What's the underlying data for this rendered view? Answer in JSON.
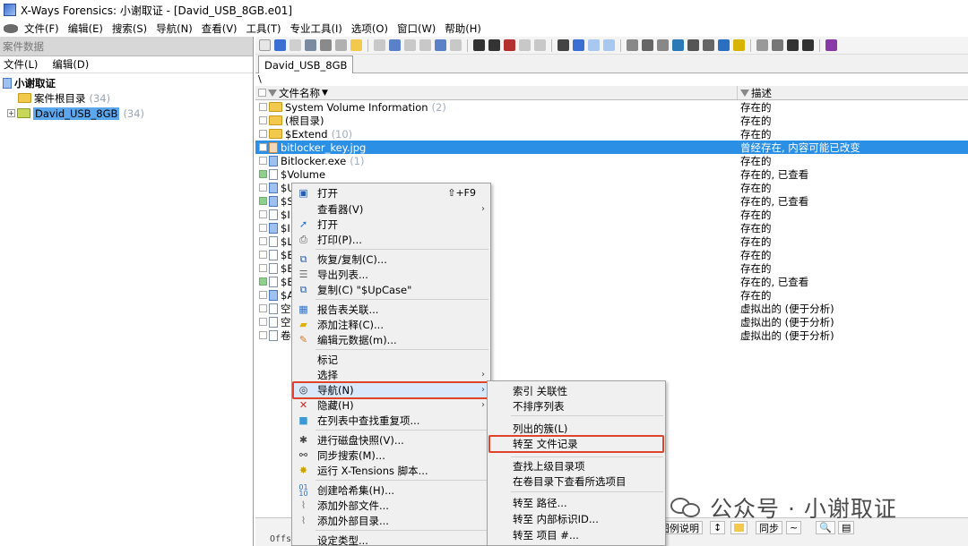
{
  "window": {
    "title": "X-Ways Forensics: 小谢取证 - [David_USB_8GB.e01]"
  },
  "menubar": [
    "文件(F)",
    "编辑(E)",
    "搜索(S)",
    "导航(N)",
    "查看(V)",
    "工具(T)",
    "专业工具(I)",
    "选项(O)",
    "窗口(W)",
    "帮助(H)"
  ],
  "left_pane": {
    "header": "案件数据",
    "menu": [
      "文件(L)",
      "编辑(D)"
    ],
    "tree": {
      "root": "小谢取证",
      "items": [
        {
          "label": "案件根目录",
          "count": "(34)"
        },
        {
          "label": "David_USB_8GB",
          "count": "(34)"
        }
      ]
    }
  },
  "tab": {
    "label": "David_USB_8GB"
  },
  "path": "\\",
  "columns": {
    "name": "文件名称",
    "desc": "描述"
  },
  "rows": [
    {
      "name": "System Volume Information",
      "count": "(2)",
      "desc": "存在的"
    },
    {
      "name": "(根目录)",
      "count": "",
      "desc": "存在的"
    },
    {
      "name": "$Extend",
      "count": "(10)",
      "desc": "存在的"
    },
    {
      "name": "bitlocker_key.jpg",
      "count": "",
      "desc": "曾经存在, 内容可能已改变"
    },
    {
      "name": "Bitlocker.exe",
      "count": "(1)",
      "desc": "存在的"
    },
    {
      "name": "$Volume",
      "count": "",
      "desc": "存在的, 已查看"
    },
    {
      "name": "$U",
      "count": "",
      "desc": "存在的"
    },
    {
      "name": "$S",
      "count": "",
      "desc": "存在的, 已查看"
    },
    {
      "name": "$I",
      "count": "",
      "desc": "存在的"
    },
    {
      "name": "$I",
      "count": "",
      "desc": "存在的"
    },
    {
      "name": "$L",
      "count": "",
      "desc": "存在的"
    },
    {
      "name": "$E",
      "count": "",
      "desc": "存在的"
    },
    {
      "name": "$B",
      "count": "",
      "desc": "存在的"
    },
    {
      "name": "$E",
      "count": "",
      "desc": "存在的, 已查看"
    },
    {
      "name": "$A",
      "count": "",
      "desc": "存在的"
    },
    {
      "name": "空",
      "count": "",
      "desc": "虚拟出的 (便于分析)"
    },
    {
      "name": "空",
      "count": "",
      "desc": "虚拟出的 (便于分析)"
    },
    {
      "name": "卷",
      "count": "",
      "desc": "虚拟出的 (便于分析)"
    }
  ],
  "context_menu": {
    "open1": "打开",
    "open1_shortcut": "⇧+F9",
    "viewer": "查看器(V)",
    "open2": "打开",
    "print": "打印(P)...",
    "recover": "恢复/复制(C)...",
    "export_list": "导出列表...",
    "copy": "复制(C) \"$UpCase\"",
    "report_table": "报告表关联...",
    "add_comment": "添加注释(C)...",
    "edit_meta": "编辑元数据(m)...",
    "mark": "标记",
    "select": "选择",
    "navigate": "导航(N)",
    "hide": "隐藏(H)",
    "find_dup": "在列表中查找重复项...",
    "snapshot": "进行磁盘快照(V)...",
    "sync_search": "同步搜索(M)...",
    "xtension": "运行 X-Tensions 脚本...",
    "hash_set": "创建哈希集(H)...",
    "add_ext_file": "添加外部文件...",
    "add_ext_dir": "添加外部目录...",
    "set_type": "设定类型..."
  },
  "submenu": {
    "index_rel": "索引 关联性",
    "unsorted": "不排序列表",
    "listed_clusters": "列出的簇(L)",
    "goto_file_record": "转至 文件记录",
    "find_parent": "查找上级目录项",
    "view_in_dir": "在卷目录下查看所选项目",
    "goto_path": "转至 路径...",
    "goto_internal_id": "转至 内部标识ID...",
    "goto_item": "转至 项目 #..."
  },
  "bottom": {
    "legend": "图例说明",
    "sync": "同步",
    "offs": "Offs"
  },
  "watermark": "公众号 · 小谢取证",
  "colors": {
    "selection": "#2b8fe6",
    "highlight": "#e0432b",
    "tree_selection": "#5aa7ee"
  }
}
